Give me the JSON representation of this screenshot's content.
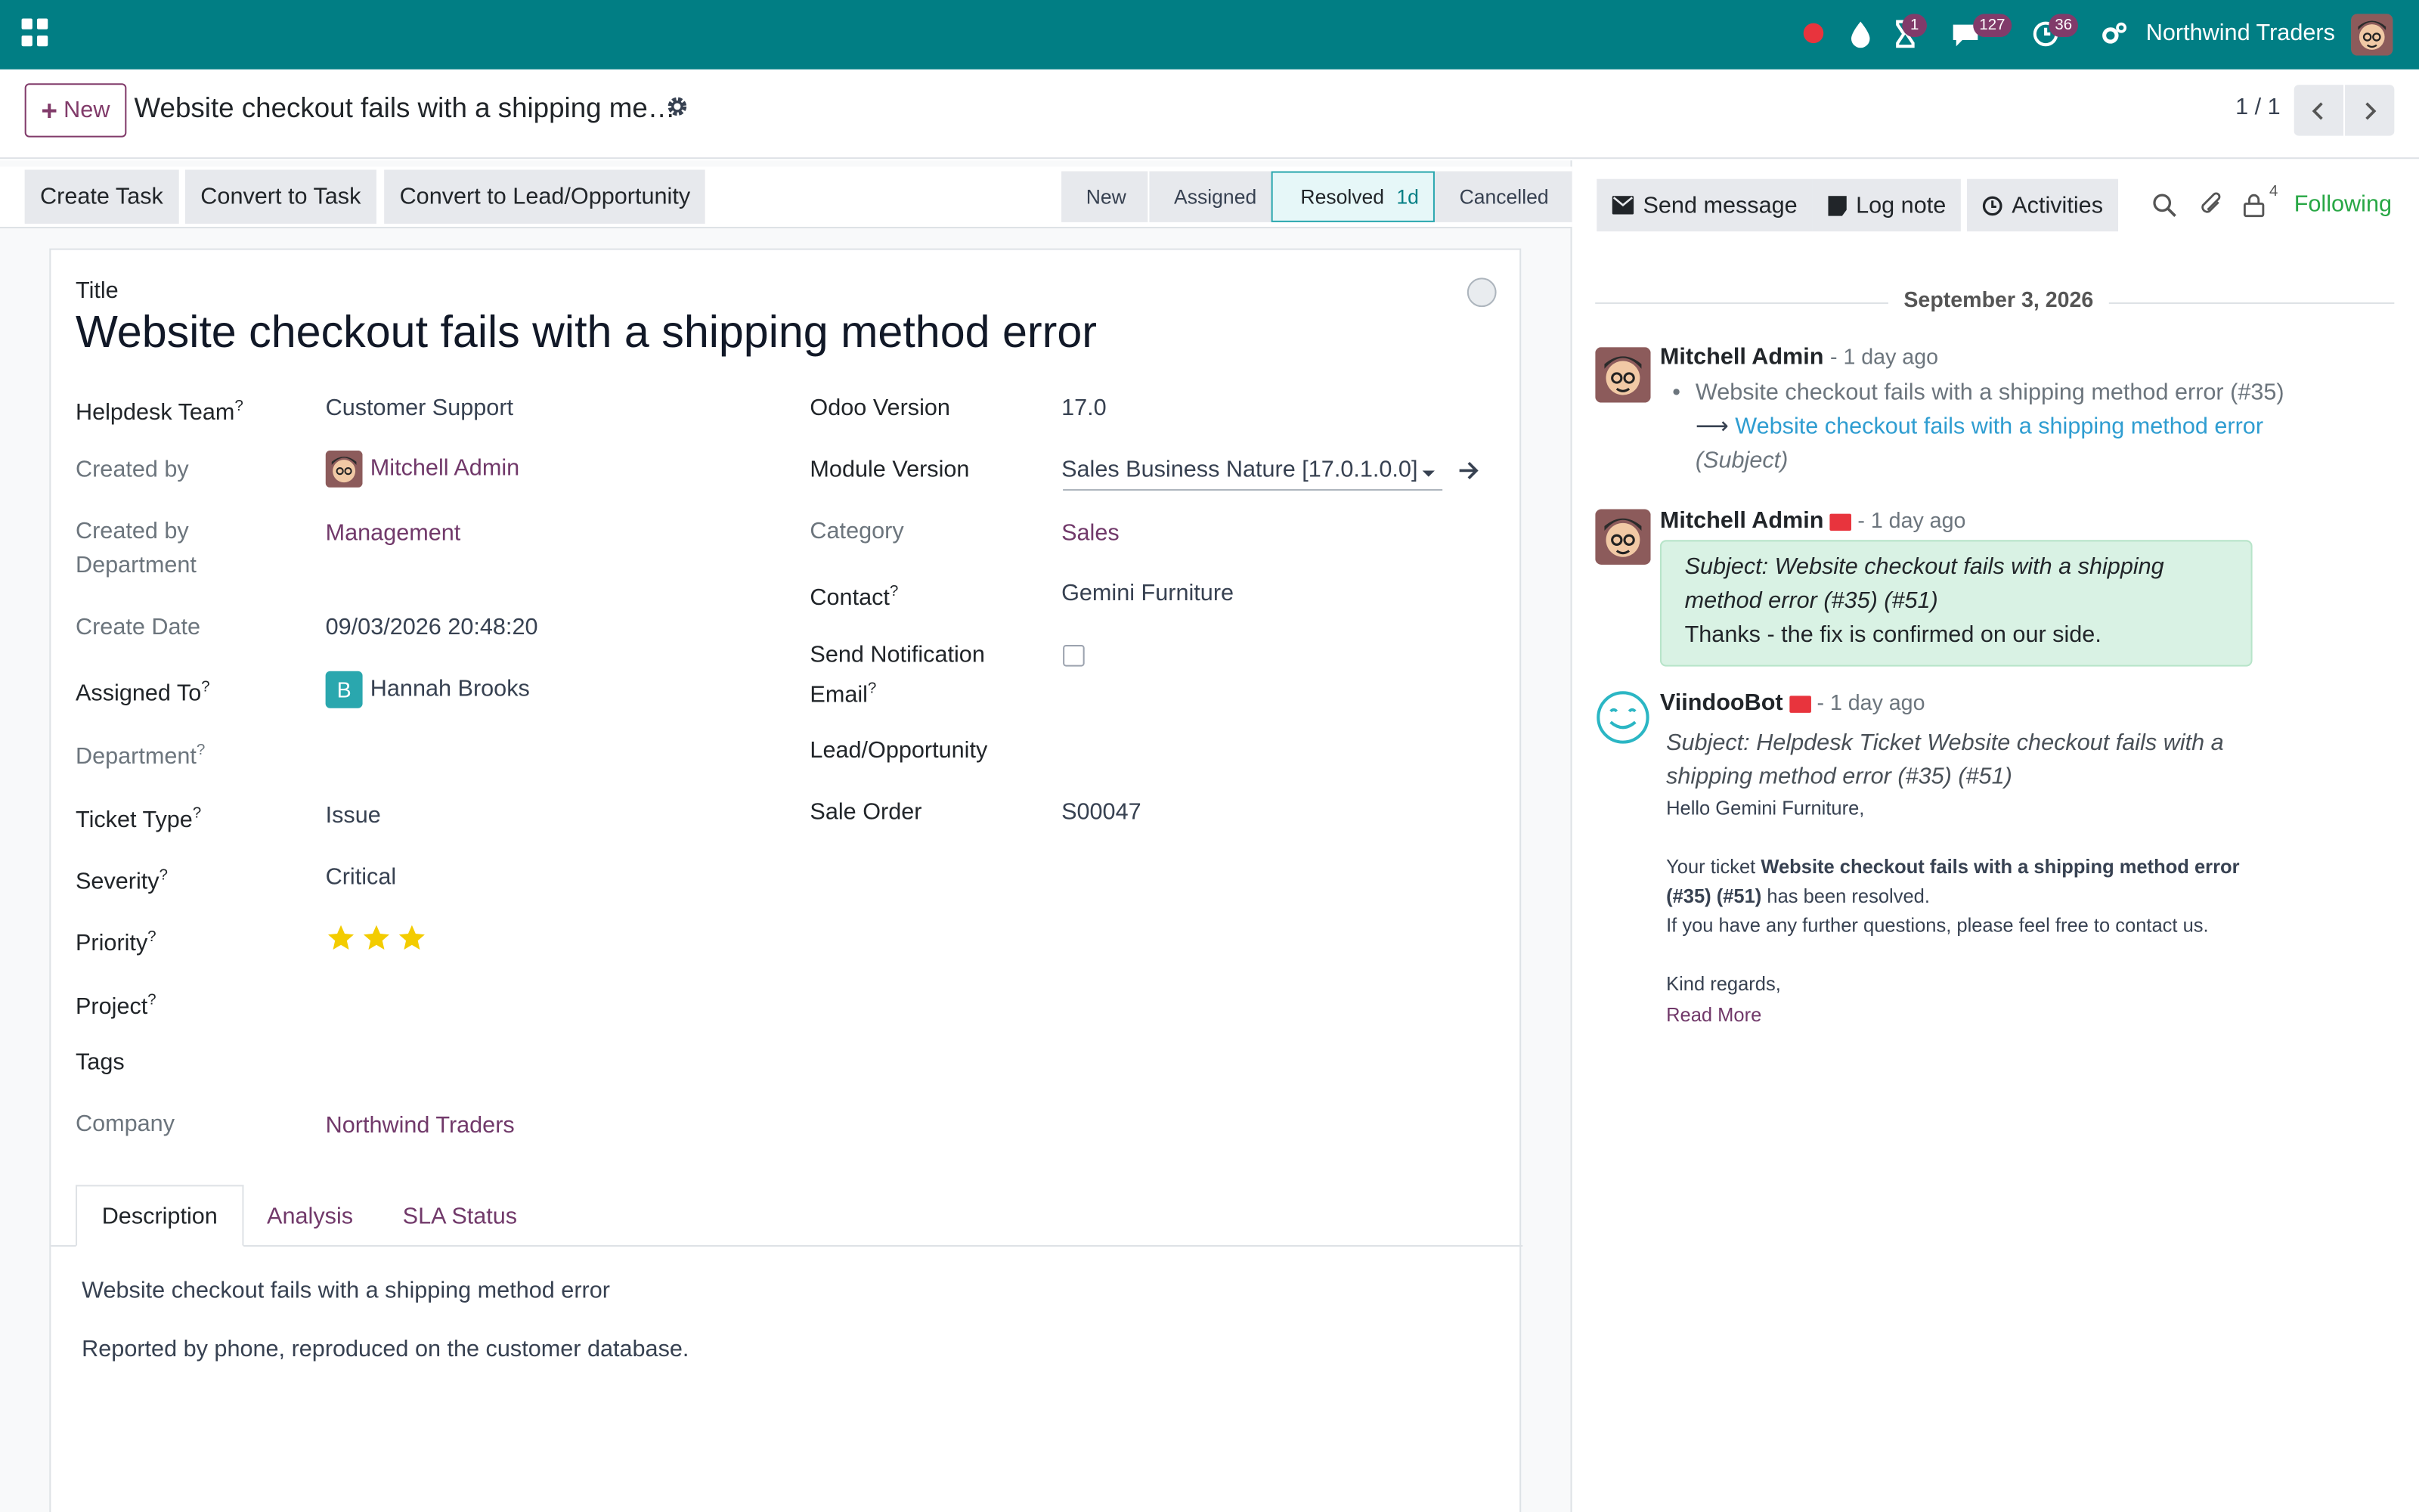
{
  "topbar": {
    "company": "Northwind Traders",
    "badges": {
      "activities": "1",
      "messages": "127",
      "clock": "36"
    }
  },
  "control": {
    "new_label": "New",
    "record_title": "Website checkout fails with a shipping me…",
    "pager": "1 / 1"
  },
  "actions": {
    "create_task": "Create Task",
    "convert_task": "Convert to Task",
    "convert_lead": "Convert to Lead/Opportunity"
  },
  "stages": [
    {
      "label": "New"
    },
    {
      "label": "Assigned"
    },
    {
      "label": "Resolved",
      "duration": "1d"
    },
    {
      "label": "Cancelled"
    }
  ],
  "form": {
    "title_label": "Title",
    "title": "Website checkout fails with a shipping method error",
    "left": {
      "helpdesk_team_label": "Helpdesk Team",
      "helpdesk_team": "Customer Support",
      "created_by_label": "Created by",
      "created_by": "Mitchell Admin",
      "created_dept_label_1": "Created by",
      "created_dept_label_2": "Department",
      "created_dept": "Management",
      "create_date_label": "Create Date",
      "create_date": "09/03/2026 20:48:20",
      "assigned_to_label": "Assigned To",
      "assigned_initial": "B",
      "assigned_to": "Hannah Brooks",
      "department_label": "Department",
      "ticket_type_label": "Ticket Type",
      "ticket_type": "Issue",
      "severity_label": "Severity",
      "severity": "Critical",
      "priority_label": "Priority",
      "priority_stars": 3,
      "project_label": "Project",
      "tags_label": "Tags",
      "company_label": "Company",
      "company": "Northwind Traders"
    },
    "right": {
      "odoo_version_label": "Odoo Version",
      "odoo_version": "17.0",
      "module_version_label": "Module Version",
      "module_version": "Sales Business Nature [17.0.1.0.0]",
      "category_label": "Category",
      "category": "Sales",
      "contact_label": "Contact",
      "contact": "Gemini Furniture",
      "send_notif_label_1": "Send Notification",
      "send_notif_label_2": "Email",
      "lead_label": "Lead/Opportunity",
      "sale_order_label": "Sale Order",
      "sale_order": "S00047"
    },
    "tabs": [
      "Description",
      "Analysis",
      "SLA Status"
    ],
    "description": [
      "Website checkout fails with a shipping method error",
      "Reported by phone, reproduced on the customer database."
    ]
  },
  "chatter": {
    "send_message": "Send message",
    "log_note": "Log note",
    "activities": "Activities",
    "followers_count": "4",
    "following": "Following",
    "date": "September 3, 2026",
    "messages": [
      {
        "author": "Mitchell Admin",
        "time": "- 1 day ago",
        "old_value": "Website checkout fails with a shipping method error (#35)",
        "new_value": "Website checkout fails with a shipping method error",
        "field": "(Subject)"
      },
      {
        "author": "Mitchell Admin",
        "time": "- 1 day ago",
        "subject": "Subject: Website checkout fails with a shipping method error (#35) (#51)",
        "body": "Thanks - the fix is confirmed on our side."
      },
      {
        "author": "ViindooBot",
        "time": "- 1 day ago",
        "subject": "Subject: Helpdesk Ticket Website checkout fails with a shipping method error (#35) (#51)",
        "greeting": "Hello Gemini Furniture,",
        "line1_pre": "Your ticket ",
        "line1_bold": "Website checkout fails with a shipping method error (#35) (#51)",
        "line1_post": " has been resolved.",
        "line2": "If you have any further questions, please feel free to contact us.",
        "closing": "Kind regards,",
        "read_more": "Read More"
      }
    ]
  },
  "colors": {
    "topbar": "#017e84",
    "brand": "#813b6a",
    "link": "#71396a",
    "following": "#28a745",
    "star": "#f3cc00"
  }
}
